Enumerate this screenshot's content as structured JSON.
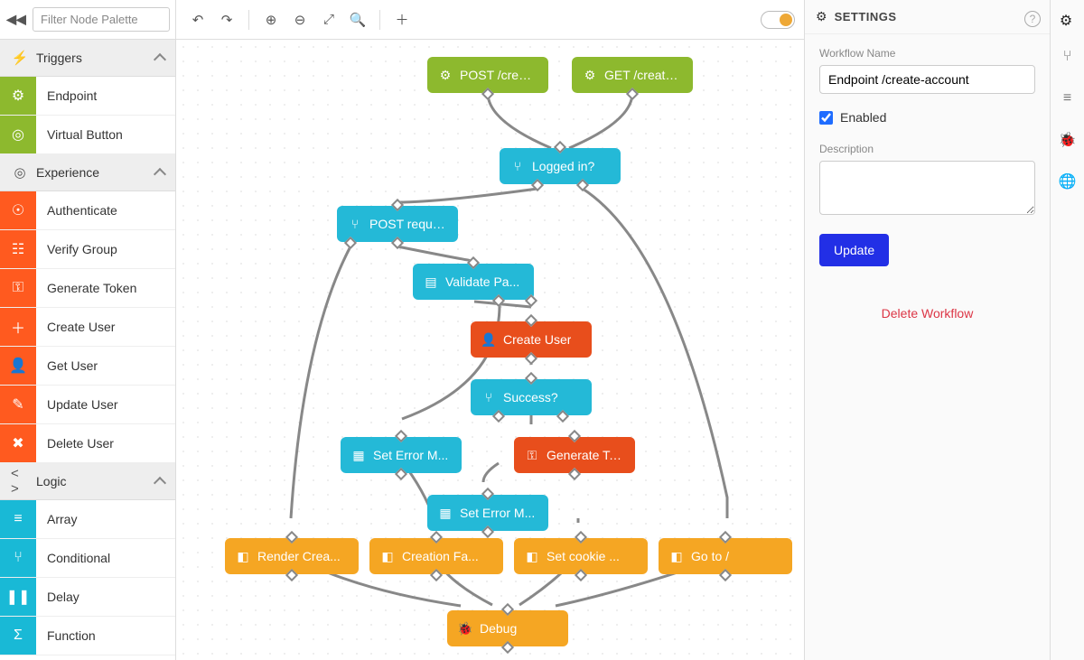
{
  "filter_placeholder": "Filter Node Palette",
  "sections": {
    "triggers": {
      "title": "Triggers",
      "items": [
        {
          "label": "Endpoint",
          "color": "#8db92e",
          "icon": "⚙"
        },
        {
          "label": "Virtual Button",
          "color": "#8db92e",
          "icon": "◎"
        }
      ]
    },
    "experience": {
      "title": "Experience",
      "items": [
        {
          "label": "Authenticate",
          "color": "#ff5a1f",
          "icon": "☉"
        },
        {
          "label": "Verify Group",
          "color": "#ff5a1f",
          "icon": "☷"
        },
        {
          "label": "Generate Token",
          "color": "#ff5a1f",
          "icon": "⚿"
        },
        {
          "label": "Create User",
          "color": "#ff5a1f",
          "icon": "＋"
        },
        {
          "label": "Get User",
          "color": "#ff5a1f",
          "icon": "👤"
        },
        {
          "label": "Update User",
          "color": "#ff5a1f",
          "icon": "✎"
        },
        {
          "label": "Delete User",
          "color": "#ff5a1f",
          "icon": "✖"
        }
      ]
    },
    "logic": {
      "title": "Logic",
      "items": [
        {
          "label": "Array",
          "color": "#19b9d6",
          "icon": "≡"
        },
        {
          "label": "Conditional",
          "color": "#19b9d6",
          "icon": "⑂"
        },
        {
          "label": "Delay",
          "color": "#19b9d6",
          "icon": "❚❚"
        },
        {
          "label": "Function",
          "color": "#19b9d6",
          "icon": "Σ"
        }
      ]
    }
  },
  "settings": {
    "header": "SETTINGS",
    "name_label": "Workflow Name",
    "name_value": "Endpoint /create-account",
    "enabled_label": "Enabled",
    "enabled_value": true,
    "description_label": "Description",
    "description_value": "",
    "update_label": "Update",
    "delete_label": "Delete Workflow"
  },
  "nodes": {
    "post_create": "POST /creat...",
    "get_create": "GET /create...",
    "logged_in": "Logged in?",
    "post_request": "POST request?",
    "validate": "Validate Pa...",
    "create_user": "Create User",
    "success": "Success?",
    "set_error1": "Set Error M...",
    "gen_token": "Generate Token",
    "set_error2": "Set Error M...",
    "render": "Render Crea...",
    "creation_fail": "Creation Fa...",
    "set_cookie": "Set cookie ...",
    "goto": "Go to /",
    "debug": "Debug"
  },
  "chart_data": {
    "type": "flowchart",
    "nodes": [
      {
        "id": "post_create",
        "label": "POST /creat...",
        "kind": "trigger",
        "color": "green"
      },
      {
        "id": "get_create",
        "label": "GET /create...",
        "kind": "trigger",
        "color": "green"
      },
      {
        "id": "logged_in",
        "label": "Logged in?",
        "kind": "conditional",
        "color": "teal"
      },
      {
        "id": "post_request",
        "label": "POST request?",
        "kind": "conditional",
        "color": "teal"
      },
      {
        "id": "validate",
        "label": "Validate Pa...",
        "kind": "action",
        "color": "teal"
      },
      {
        "id": "create_user",
        "label": "Create User",
        "kind": "action",
        "color": "red"
      },
      {
        "id": "success",
        "label": "Success?",
        "kind": "conditional",
        "color": "teal"
      },
      {
        "id": "set_error1",
        "label": "Set Error M...",
        "kind": "action",
        "color": "teal"
      },
      {
        "id": "gen_token",
        "label": "Generate Token",
        "kind": "action",
        "color": "red"
      },
      {
        "id": "set_error2",
        "label": "Set Error M...",
        "kind": "action",
        "color": "teal"
      },
      {
        "id": "render",
        "label": "Render Crea...",
        "kind": "output",
        "color": "orange"
      },
      {
        "id": "creation_fail",
        "label": "Creation Fa...",
        "kind": "output",
        "color": "orange"
      },
      {
        "id": "set_cookie",
        "label": "Set cookie ...",
        "kind": "output",
        "color": "orange"
      },
      {
        "id": "goto",
        "label": "Go to /",
        "kind": "output",
        "color": "orange"
      },
      {
        "id": "debug",
        "label": "Debug",
        "kind": "output",
        "color": "orange"
      }
    ],
    "edges": [
      [
        "post_create",
        "logged_in"
      ],
      [
        "get_create",
        "logged_in"
      ],
      [
        "logged_in",
        "post_request"
      ],
      [
        "logged_in",
        "goto"
      ],
      [
        "post_request",
        "validate"
      ],
      [
        "post_request",
        "render"
      ],
      [
        "validate",
        "create_user"
      ],
      [
        "validate",
        "set_error1"
      ],
      [
        "create_user",
        "success"
      ],
      [
        "success",
        "set_error2"
      ],
      [
        "success",
        "gen_token"
      ],
      [
        "set_error1",
        "creation_fail"
      ],
      [
        "set_error2",
        "creation_fail"
      ],
      [
        "gen_token",
        "set_cookie"
      ],
      [
        "render",
        "debug"
      ],
      [
        "creation_fail",
        "debug"
      ],
      [
        "set_cookie",
        "debug"
      ],
      [
        "goto",
        "debug"
      ]
    ]
  }
}
